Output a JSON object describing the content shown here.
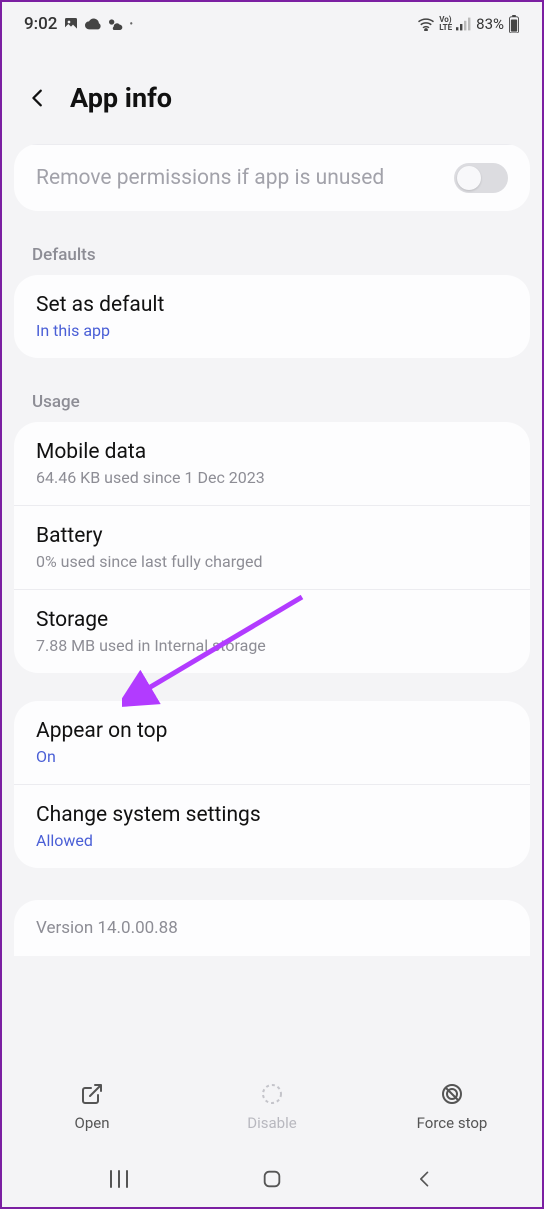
{
  "status": {
    "time": "9:02",
    "battery": "83%"
  },
  "header": {
    "title": "App info"
  },
  "permissions": {
    "remove_label": "Remove permissions if app is unused"
  },
  "sections": {
    "defaults_label": "Defaults",
    "usage_label": "Usage"
  },
  "set_default": {
    "title": "Set as default",
    "sub": "In this app"
  },
  "mobile_data": {
    "title": "Mobile data",
    "sub": "64.46 KB used since 1 Dec 2023"
  },
  "battery": {
    "title": "Battery",
    "sub": "0% used since last fully charged"
  },
  "storage": {
    "title": "Storage",
    "sub": "7.88 MB used in Internal storage"
  },
  "appear_on_top": {
    "title": "Appear on top",
    "sub": "On"
  },
  "change_system": {
    "title": "Change system settings",
    "sub": "Allowed"
  },
  "version": {
    "text": "Version 14.0.00.88"
  },
  "actions": {
    "open": "Open",
    "disable": "Disable",
    "force_stop": "Force stop"
  }
}
